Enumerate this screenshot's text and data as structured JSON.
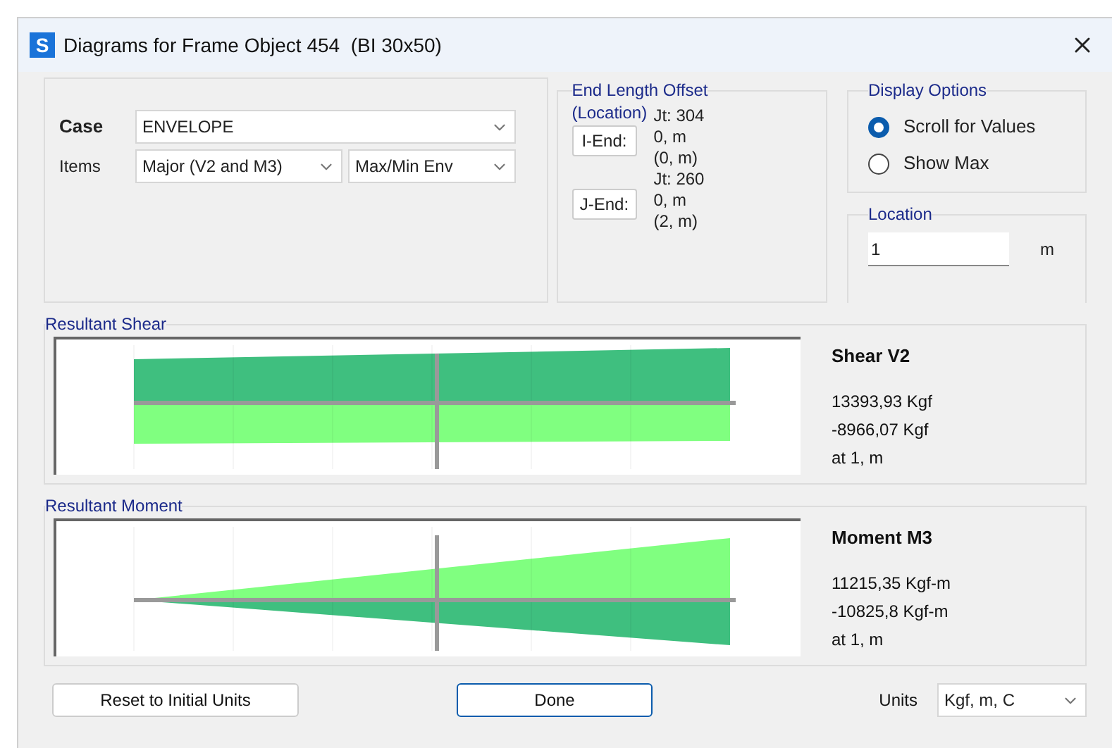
{
  "window": {
    "title": "Diagrams for Frame Object 454  (BI 30x50)",
    "app_icon": "S"
  },
  "case": {
    "label": "Case",
    "value": "ENVELOPE"
  },
  "items": {
    "label": "Items",
    "value": "Major (V2 and M3)",
    "value2": "Max/Min Env"
  },
  "end_offset": {
    "title": "End Length Offset",
    "subtitle": "(Location)",
    "ends": [
      {
        "button": "I-End:",
        "jt": "Jt:  304",
        "offset": "0, m",
        "location": "(0, m)"
      },
      {
        "button": "J-End:",
        "jt": "Jt:  260",
        "offset": "0, m",
        "location": "(2, m)"
      }
    ]
  },
  "display_options": {
    "title": "Display Options",
    "options": [
      {
        "label": "Scroll for Values",
        "selected": true
      },
      {
        "label": "Show Max",
        "selected": false
      }
    ]
  },
  "location": {
    "title": "Location",
    "value": "1",
    "unit": "m"
  },
  "panels": [
    {
      "kind": "shear",
      "title": "Resultant Shear",
      "heading": "Shear V2",
      "lines": [
        "13393,93 Kgf",
        "-8966,07 Kgf",
        "at 1, m"
      ]
    },
    {
      "kind": "moment",
      "title": "Resultant Moment",
      "heading": "Moment M3",
      "lines": [
        "11215,35 Kgf-m",
        "-10825,8 Kgf-m",
        "at 1, m"
      ]
    }
  ],
  "buttons": {
    "reset": "Reset to Initial Units",
    "done": "Done"
  },
  "units": {
    "label": "Units",
    "value": "Kgf, m, C"
  }
}
